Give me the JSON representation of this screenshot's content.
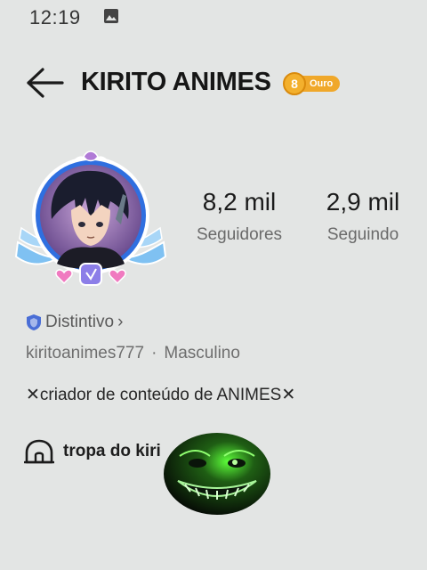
{
  "status_bar": {
    "time": "12:19",
    "icon": "image-icon"
  },
  "header": {
    "back_icon": "back-arrow-icon",
    "title": "KIRITO ANIMES",
    "level_number": "8",
    "level_label": "Ouro"
  },
  "stats": {
    "followers": {
      "value": "8,2 mil",
      "label": "Seguidores"
    },
    "following": {
      "value": "2,9 mil",
      "label": "Seguindo"
    }
  },
  "badge_link": {
    "label": "Distintivo",
    "chevron": "›"
  },
  "profile": {
    "username": "kiritoanimes777",
    "separator": "·",
    "gender": "Masculino",
    "bio": "✕criador de conteúdo de ANIMES✕"
  },
  "group": {
    "icon": "tent-icon",
    "name": "tropa do kiri"
  },
  "colors": {
    "background": "#e3e5e4",
    "badge_gold": "#f0a82a",
    "frame_blue": "#2f6fe0",
    "shield_blue": "#4a6ed6"
  }
}
